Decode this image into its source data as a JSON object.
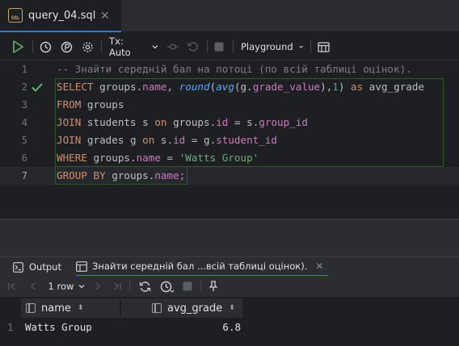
{
  "tab": {
    "filename": "query_04.sql",
    "icon_label": "SQL",
    "close": "✕"
  },
  "toolbar": {
    "tx_mode": "Tx: Auto",
    "session": "Playground"
  },
  "editor": {
    "line_numbers": [
      "1",
      "2",
      "3",
      "4",
      "5",
      "6",
      "7"
    ],
    "lines": {
      "l1": "-- Знайти середній бал на потоці (по всій таблиці оцінок).",
      "l2": {
        "kw1": "SELECT",
        "t1": " groups.",
        "f1": "name",
        "t2": ", ",
        "fn1": "round",
        "t3": "(",
        "fn2": "avg",
        "t4": "(g.",
        "f2": "grade_value",
        "t5": "),",
        "n1": "1",
        "t6": ") ",
        "kw2": "as",
        "t7": " avg_grade"
      },
      "l3": {
        "kw1": "FROM",
        "t1": " groups"
      },
      "l4": {
        "kw1": "JOIN",
        "t1": " students s ",
        "kw2": "on",
        "t2": " groups.",
        "f1": "id",
        "t3": " = s.",
        "f2": "group_id"
      },
      "l5": {
        "kw1": "JOIN",
        "t1": " grades g ",
        "kw2": "on",
        "t2": " s.",
        "f1": "id",
        "t3": " = g.",
        "f2": "student_id"
      },
      "l6": {
        "kw1": "WHERE",
        "t1": " groups.",
        "f1": "name",
        "t2": " = ",
        "s1": "'Watts Group'"
      },
      "l7": {
        "kw1": "GROUP BY",
        "t1": " groups.",
        "f1": "name",
        "t2": ";"
      }
    }
  },
  "bottom": {
    "tabs": {
      "output": "Output",
      "result": "Знайти середній бал ...всій таблиці оцінок).",
      "close": "✕"
    },
    "rowcount": "1 row",
    "columns": {
      "c1": "name",
      "c2": "avg_grade"
    },
    "rows": [
      {
        "num": "1",
        "name": "Watts Group",
        "avg_grade": "6.8"
      }
    ]
  },
  "colors": {
    "accent": "#3574f0",
    "keyword": "#cf8e6d",
    "function": "#56a8f5",
    "field": "#c77dbb",
    "string": "#6aab73",
    "number": "#2aacb8",
    "success": "#5fb865"
  }
}
